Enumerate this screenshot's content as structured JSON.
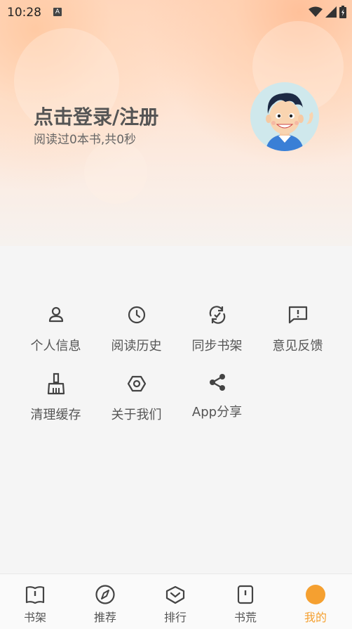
{
  "status_bar": {
    "time": "10:28",
    "notification_glyph": "A"
  },
  "profile": {
    "login_title": "点击登录/注册",
    "reading_stats": "阅读过0本书,共0秒"
  },
  "grid_items": [
    {
      "label": "个人信息",
      "icon": "person-icon"
    },
    {
      "label": "阅读历史",
      "icon": "clock-icon"
    },
    {
      "label": "同步书架",
      "icon": "sync-icon"
    },
    {
      "label": "意见反馈",
      "icon": "feedback-icon"
    },
    {
      "label": "清理缓存",
      "icon": "broom-icon"
    },
    {
      "label": "关于我们",
      "icon": "hexagon-icon"
    },
    {
      "label": "App分享",
      "icon": "share-icon"
    }
  ],
  "bottom_nav": [
    {
      "label": "书架",
      "icon": "book-icon"
    },
    {
      "label": "推荐",
      "icon": "compass-icon"
    },
    {
      "label": "排行",
      "icon": "ranking-icon"
    },
    {
      "label": "书荒",
      "icon": "book-alert-icon"
    },
    {
      "label": "我的",
      "icon": "profile-dot-icon",
      "active": true
    }
  ],
  "colors": {
    "accent": "#f5a030",
    "text": "#555555",
    "icon": "#444444"
  }
}
